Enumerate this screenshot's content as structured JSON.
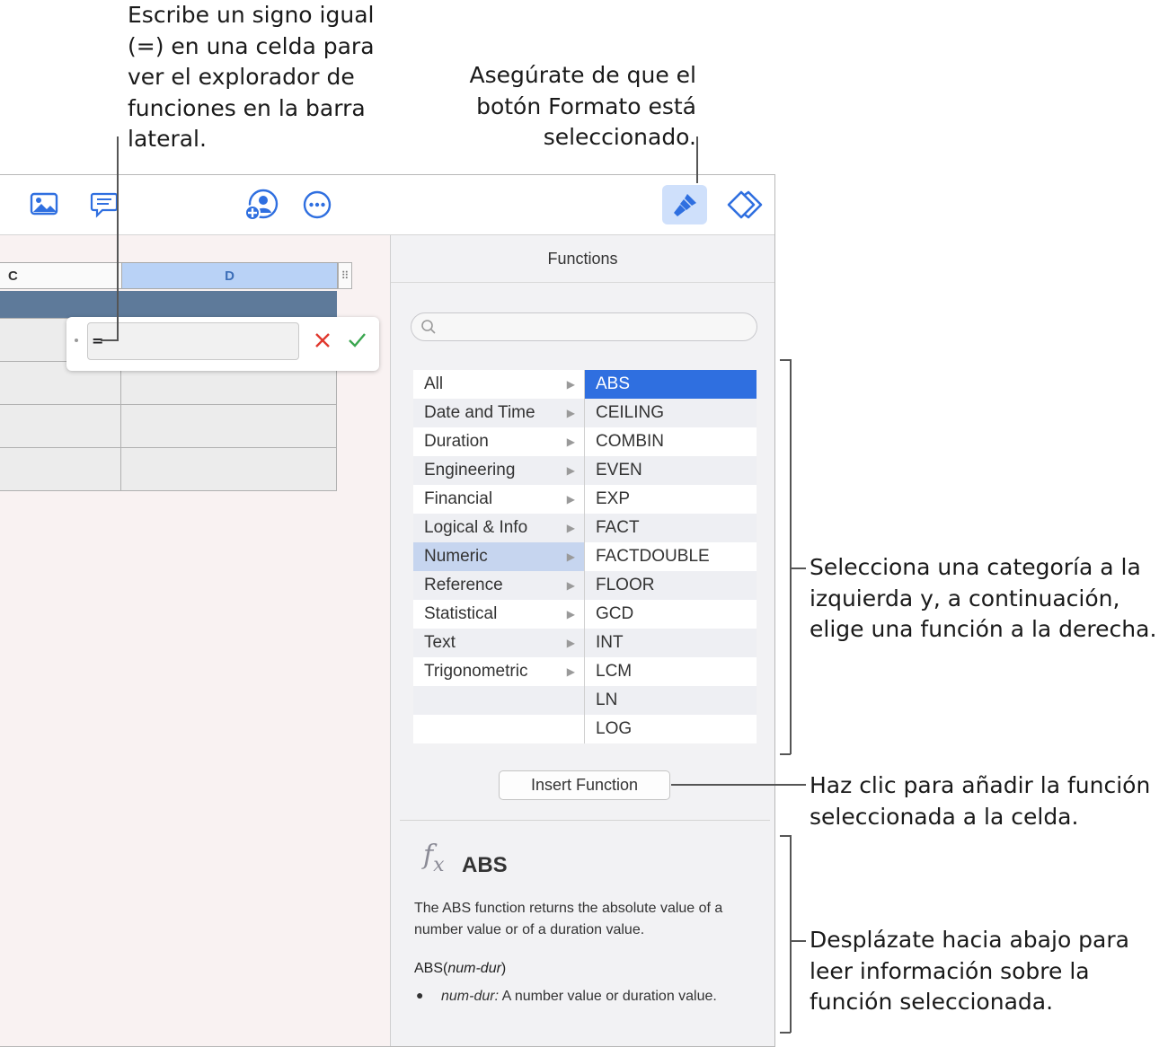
{
  "callouts": {
    "top_left": "Escribe un signo igual\n(=) en una celda para\nver el explorador de\nfunciones en la barra\nlateral.",
    "top_right": "Asegúrate de que el\nbotón Formato está\nseleccionado.",
    "middle_right": "Selecciona una categoría a la\nizquierda y, a continuación,\nelige una función a la derecha.",
    "insert_right": "Haz clic para añadir la función\nseleccionada a la celda.",
    "bottom_right": "Desplázate hacia abajo para\nleer información sobre la\nfunción seleccionada."
  },
  "toolbar": {
    "icons": [
      "media-icon",
      "comment-icon",
      "collaborate-icon",
      "more-icon",
      "format-icon",
      "organize-icon"
    ],
    "selected": "format-icon",
    "accent": "#2f6fe0"
  },
  "sheet": {
    "columns": [
      "C",
      "D"
    ],
    "selected_column": "D",
    "formula_text": "="
  },
  "sidebar": {
    "title": "Functions",
    "search_placeholder": "",
    "categories": [
      "All",
      "Date and Time",
      "Duration",
      "Engineering",
      "Financial",
      "Logical & Info",
      "Numeric",
      "Reference",
      "Statistical",
      "Text",
      "Trigonometric"
    ],
    "selected_category": "Numeric",
    "functions": [
      "ABS",
      "CEILING",
      "COMBIN",
      "EVEN",
      "EXP",
      "FACT",
      "FACTDOUBLE",
      "FLOOR",
      "GCD",
      "INT",
      "LCM",
      "LN",
      "LOG"
    ],
    "selected_function": "ABS",
    "insert_button": "Insert Function",
    "detail": {
      "icon": "fx-icon",
      "name": "ABS",
      "description": "The ABS function returns the absolute value of a number value or of a duration value.",
      "syntax_name": "ABS",
      "syntax_arg": "num-dur",
      "arg_name": "num-dur:",
      "arg_desc": " A number value or duration value."
    }
  }
}
